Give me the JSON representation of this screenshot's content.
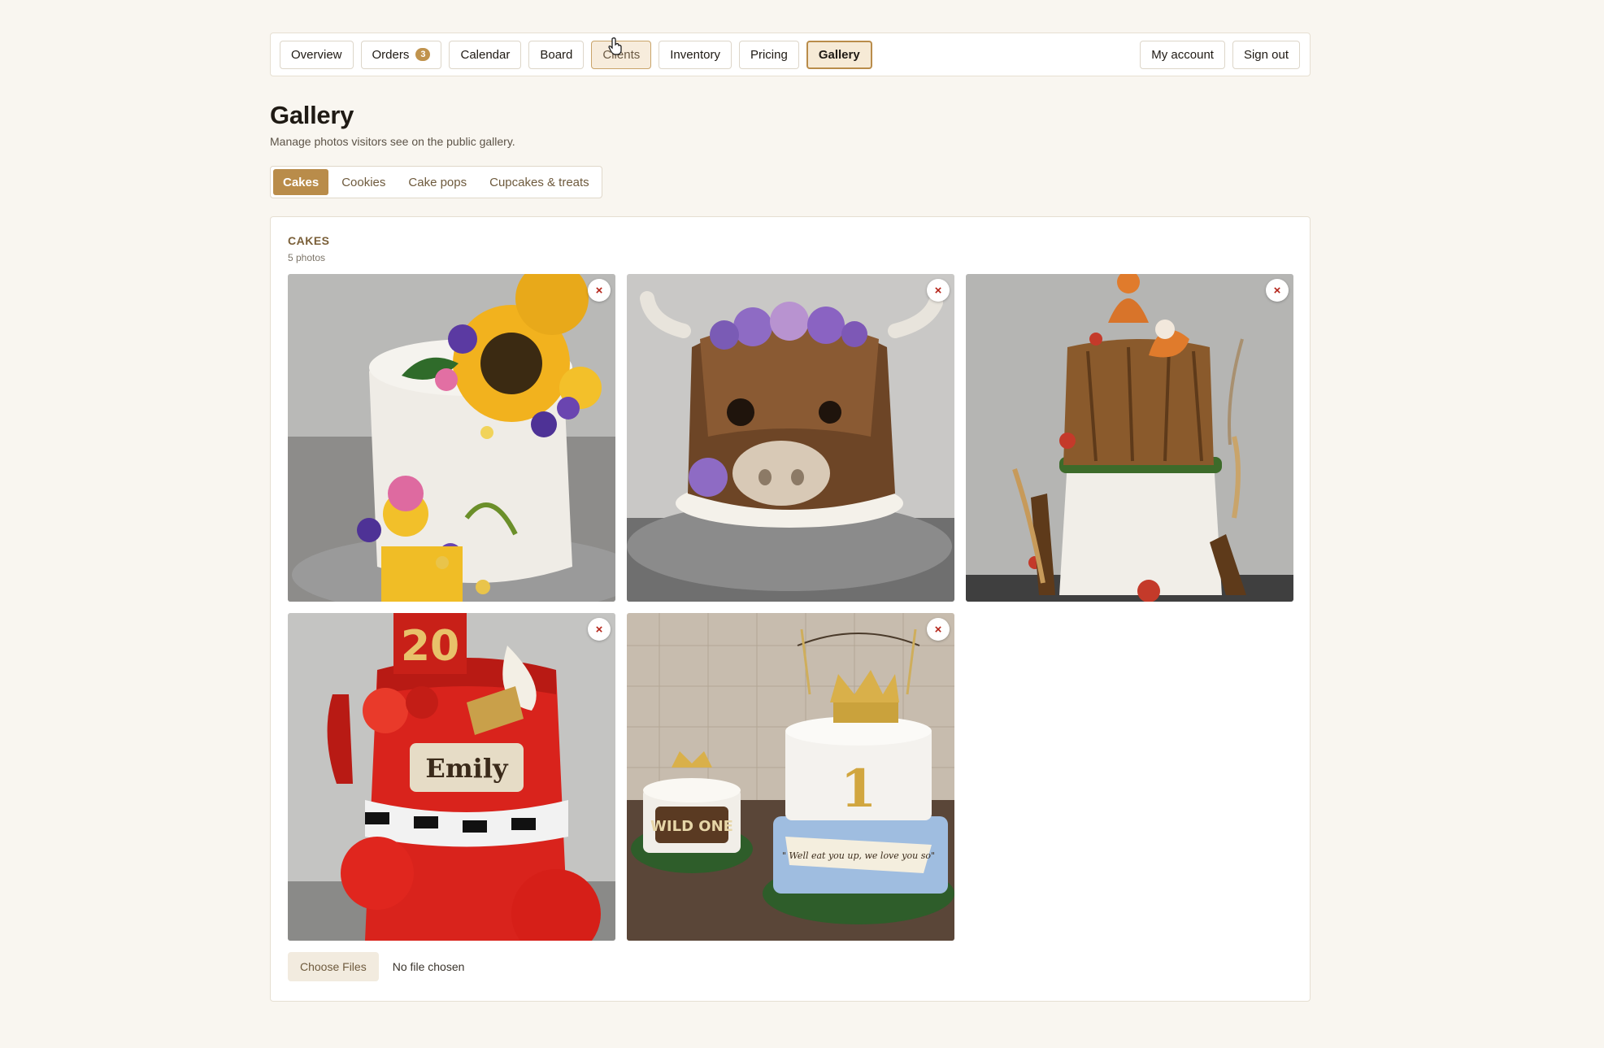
{
  "nav": {
    "items": [
      {
        "label": "Overview"
      },
      {
        "label": "Orders",
        "badge": "3"
      },
      {
        "label": "Calendar"
      },
      {
        "label": "Board"
      },
      {
        "label": "Clients"
      },
      {
        "label": "Inventory"
      },
      {
        "label": "Pricing"
      },
      {
        "label": "Gallery"
      }
    ],
    "account": "My account",
    "signout": "Sign out"
  },
  "page": {
    "title": "Gallery",
    "subtitle": "Manage photos visitors see on the public gallery."
  },
  "categories": [
    "Cakes",
    "Cookies",
    "Cake pops",
    "Cupcakes & treats"
  ],
  "section": {
    "title": "CAKES",
    "count": "5 photos"
  },
  "photos": [
    {
      "subject": "white cake with sunflowers and purple flowers",
      "remove": "×"
    },
    {
      "subject": "highland cow cake with purple roses",
      "remove": "×"
    },
    {
      "subject": "woodland stump cake with foxes",
      "remove": "×"
    },
    {
      "subject": "red Emily 20th birthday cake",
      "text": "Emily",
      "number": "20",
      "remove": "×"
    },
    {
      "subject": "Wild One first birthday cakes",
      "text": "WILD ONE",
      "number": "1",
      "quote": "\" Well eat you up, we love you so\"",
      "remove": "×"
    }
  ],
  "upload": {
    "button": "Choose Files",
    "status": "No file chosen"
  },
  "colors": {
    "accent": "#b98c4a",
    "background": "#f9f6f0",
    "danger": "#b42318"
  }
}
